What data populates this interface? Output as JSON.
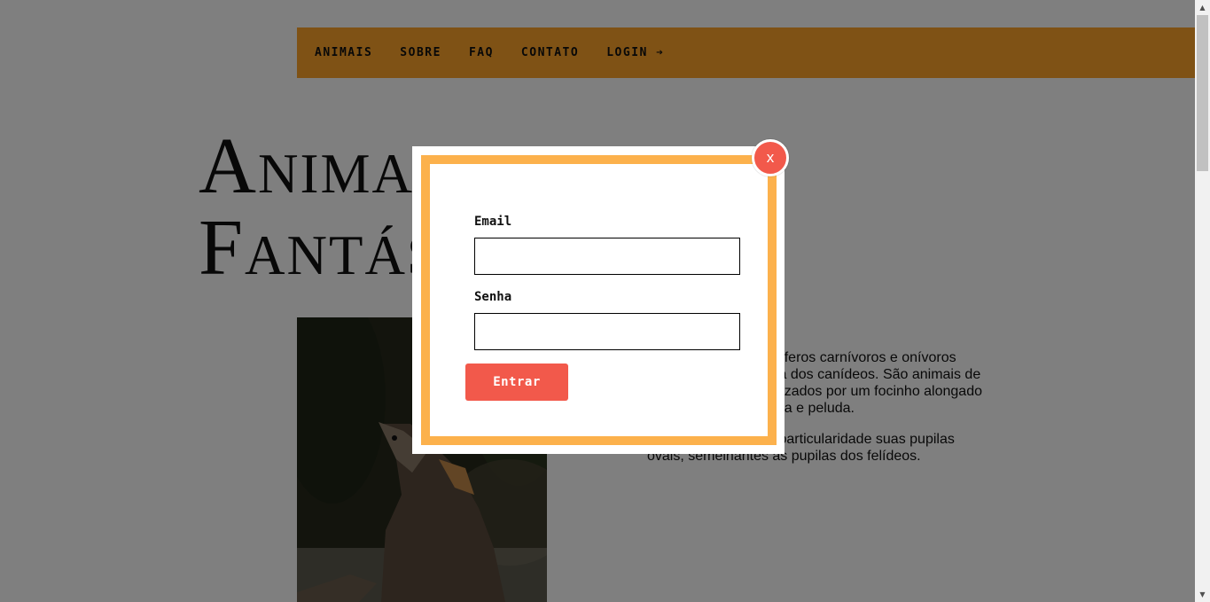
{
  "nav": {
    "items": [
      {
        "label": "ANIMAIS"
      },
      {
        "label": "SOBRE"
      },
      {
        "label": "FAQ"
      },
      {
        "label": "CONTATO"
      },
      {
        "label": "LOGIN ➔"
      }
    ]
  },
  "hero": {
    "title_line1": "Animais",
    "title_line2": "Fantásticos"
  },
  "article": {
    "paragraph1": "As raposas são mamíferos carnívoros e onívoros pertencentes à família dos canídeos. São animais de porte médio, caracterizados por um focinho alongado e por uma cauda longa e peluda.",
    "paragraph2": "Elas possuem como particularidade suas pupilas ovais, semelhantes às pupilas dos felídeos."
  },
  "modal": {
    "email_label": "Email",
    "email_value": "",
    "password_label": "Senha",
    "password_value": "",
    "submit_label": "Entrar",
    "close_label": "x"
  },
  "colors": {
    "menu_bg": "#fea52b",
    "modal_border": "#fcb14c",
    "accent_red": "#f2594b",
    "overlay": "rgba(0,0,0,0.5)"
  },
  "icons": {
    "close": "close-icon",
    "login_arrow": "arrow-right-icon"
  }
}
